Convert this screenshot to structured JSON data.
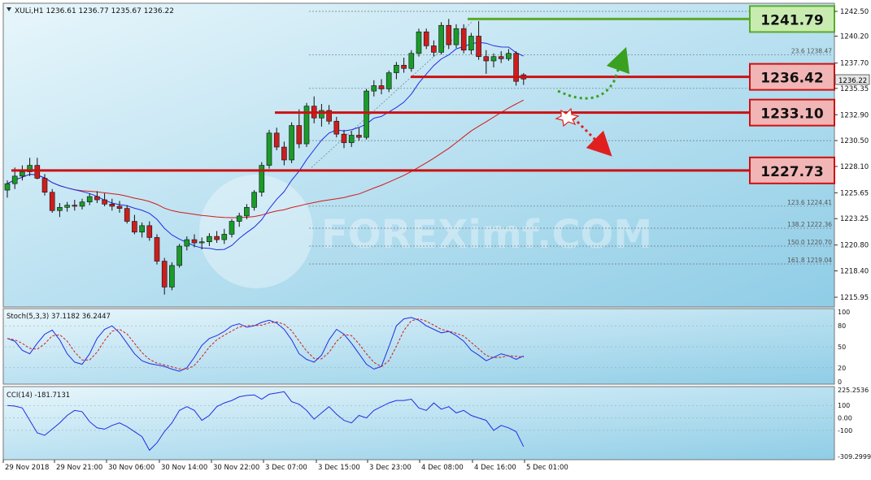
{
  "header": {
    "symbol_line": "XULi,H1  1236.61 1236.77 1235.67 1236.22"
  },
  "watermark": "FOREXimf.COM",
  "price_axis": {
    "ticks": [
      "1242.50",
      "1240.20",
      "1237.70",
      "1235.35",
      "1232.90",
      "1230.50",
      "1228.10",
      "1225.65",
      "1223.25",
      "1220.80",
      "1218.40",
      "1215.95"
    ],
    "current_price": "1236.22"
  },
  "fib_labels": [
    "23.6 1238.47",
    "123.6 1224.41",
    "138.2 1222.36",
    "150.0 1220.70",
    "161.8 1219.04"
  ],
  "key_levels": [
    {
      "label": "1241.79",
      "value": 1241.79,
      "kind": "resistance"
    },
    {
      "label": "1236.42",
      "value": 1236.42,
      "kind": "pivot"
    },
    {
      "label": "1233.10",
      "value": 1233.1,
      "kind": "support"
    },
    {
      "label": "1227.73",
      "value": 1227.73,
      "kind": "support"
    }
  ],
  "time_axis": [
    "29 Nov 2018",
    "29 Nov 21:00",
    "30 Nov 06:00",
    "30 Nov 14:00",
    "30 Nov 22:00",
    "3 Dec 07:00",
    "3 Dec 15:00",
    "3 Dec 23:00",
    "4 Dec 08:00",
    "4 Dec 16:00",
    "5 Dec 01:00"
  ],
  "stoch": {
    "label": "Stoch(5,3,3) 37.1182 36.2447",
    "ticks": [
      "100",
      "80",
      "50",
      "20",
      "0"
    ]
  },
  "cci": {
    "label": "CCI(14) -181.7131",
    "ticks": [
      "225.2536",
      "100",
      "0.00",
      "-100",
      "-309.2999"
    ]
  },
  "colors": {
    "bull": "#1a9b2a",
    "bear": "#cc1e1e",
    "ma_fast": "#1e2ee6",
    "ma_slow": "#d11b1b",
    "resistance_box": "#c8ecb0",
    "support_box": "#f2b5b5"
  },
  "chart_data": {
    "type": "candlestick",
    "title": "XULi,H1",
    "ylim": [
      1215.95,
      1242.5
    ],
    "last": {
      "open": 1236.61,
      "high": 1236.77,
      "low": 1235.67,
      "close": 1236.22
    },
    "candles": [
      [
        1225.9,
        1226.8,
        1225.2,
        1226.5
      ],
      [
        1226.5,
        1228.0,
        1226.0,
        1227.2
      ],
      [
        1227.2,
        1228.2,
        1226.8,
        1227.6
      ],
      [
        1227.6,
        1228.9,
        1227.2,
        1228.2
      ],
      [
        1228.2,
        1228.9,
        1226.9,
        1227.0
      ],
      [
        1227.0,
        1227.4,
        1225.4,
        1225.7
      ],
      [
        1225.7,
        1226.0,
        1223.8,
        1224.0
      ],
      [
        1224.0,
        1224.7,
        1223.4,
        1224.3
      ],
      [
        1224.3,
        1224.8,
        1223.9,
        1224.5
      ],
      [
        1224.5,
        1225.0,
        1224.0,
        1224.4
      ],
      [
        1224.4,
        1225.1,
        1224.1,
        1224.8
      ],
      [
        1224.8,
        1225.6,
        1224.5,
        1225.3
      ],
      [
        1225.3,
        1225.8,
        1224.7,
        1225.0
      ],
      [
        1225.0,
        1225.6,
        1224.4,
        1224.6
      ],
      [
        1224.6,
        1225.1,
        1224.0,
        1224.4
      ],
      [
        1224.4,
        1224.9,
        1223.8,
        1224.2
      ],
      [
        1224.2,
        1224.5,
        1222.8,
        1223.0
      ],
      [
        1223.0,
        1223.6,
        1221.8,
        1222.0
      ],
      [
        1222.0,
        1222.9,
        1221.5,
        1222.6
      ],
      [
        1222.6,
        1223.0,
        1221.2,
        1221.5
      ],
      [
        1221.5,
        1221.8,
        1219.0,
        1219.3
      ],
      [
        1219.3,
        1219.6,
        1216.2,
        1216.9
      ],
      [
        1216.9,
        1219.2,
        1216.6,
        1218.9
      ],
      [
        1218.9,
        1220.9,
        1218.7,
        1220.7
      ],
      [
        1220.7,
        1221.6,
        1220.3,
        1221.3
      ],
      [
        1221.3,
        1221.8,
        1220.6,
        1221.0
      ],
      [
        1221.0,
        1221.5,
        1220.4,
        1221.1
      ],
      [
        1221.1,
        1221.9,
        1220.7,
        1221.6
      ],
      [
        1221.6,
        1222.1,
        1221.0,
        1221.3
      ],
      [
        1221.3,
        1222.3,
        1220.9,
        1221.8
      ],
      [
        1221.8,
        1223.2,
        1221.5,
        1223.0
      ],
      [
        1223.0,
        1223.8,
        1222.5,
        1223.5
      ],
      [
        1223.5,
        1224.6,
        1223.2,
        1224.3
      ],
      [
        1224.3,
        1225.9,
        1224.0,
        1225.7
      ],
      [
        1225.7,
        1228.5,
        1225.3,
        1228.2
      ],
      [
        1228.2,
        1231.5,
        1227.9,
        1231.2
      ],
      [
        1231.2,
        1231.7,
        1229.6,
        1229.9
      ],
      [
        1229.9,
        1230.4,
        1228.2,
        1228.7
      ],
      [
        1228.7,
        1232.2,
        1228.4,
        1231.9
      ],
      [
        1231.9,
        1233.4,
        1229.8,
        1230.2
      ],
      [
        1230.2,
        1234.0,
        1229.9,
        1233.7
      ],
      [
        1233.7,
        1234.6,
        1232.1,
        1232.6
      ],
      [
        1232.6,
        1233.9,
        1231.8,
        1233.3
      ],
      [
        1233.3,
        1233.8,
        1232.0,
        1232.3
      ],
      [
        1232.3,
        1232.7,
        1230.8,
        1231.1
      ],
      [
        1231.1,
        1231.5,
        1229.8,
        1230.3
      ],
      [
        1230.3,
        1231.4,
        1229.9,
        1231.0
      ],
      [
        1231.0,
        1231.7,
        1230.5,
        1230.8
      ],
      [
        1230.8,
        1235.3,
        1230.6,
        1235.1
      ],
      [
        1235.1,
        1236.1,
        1234.6,
        1235.6
      ],
      [
        1235.6,
        1236.2,
        1234.8,
        1235.3
      ],
      [
        1235.3,
        1237.0,
        1235.0,
        1236.8
      ],
      [
        1236.8,
        1237.8,
        1236.2,
        1237.5
      ],
      [
        1237.5,
        1238.2,
        1236.8,
        1237.2
      ],
      [
        1237.2,
        1238.9,
        1236.9,
        1238.6
      ],
      [
        1238.6,
        1240.9,
        1238.3,
        1240.6
      ],
      [
        1240.6,
        1240.9,
        1239.0,
        1239.3
      ],
      [
        1239.3,
        1239.8,
        1238.3,
        1238.7
      ],
      [
        1238.7,
        1241.5,
        1238.5,
        1241.2
      ],
      [
        1241.2,
        1241.8,
        1239.0,
        1239.4
      ],
      [
        1239.4,
        1241.3,
        1239.1,
        1240.9
      ],
      [
        1240.9,
        1241.3,
        1238.6,
        1238.9
      ],
      [
        1238.9,
        1240.5,
        1238.5,
        1240.2
      ],
      [
        1240.2,
        1241.6,
        1238.0,
        1238.3
      ],
      [
        1238.3,
        1238.9,
        1236.7,
        1237.9
      ],
      [
        1237.9,
        1238.6,
        1237.3,
        1238.3
      ],
      [
        1238.3,
        1238.8,
        1237.7,
        1238.1
      ],
      [
        1238.1,
        1239.0,
        1237.9,
        1238.6
      ],
      [
        1238.6,
        1238.8,
        1235.6,
        1236.0
      ],
      [
        1236.61,
        1236.77,
        1235.67,
        1236.22
      ]
    ]
  }
}
